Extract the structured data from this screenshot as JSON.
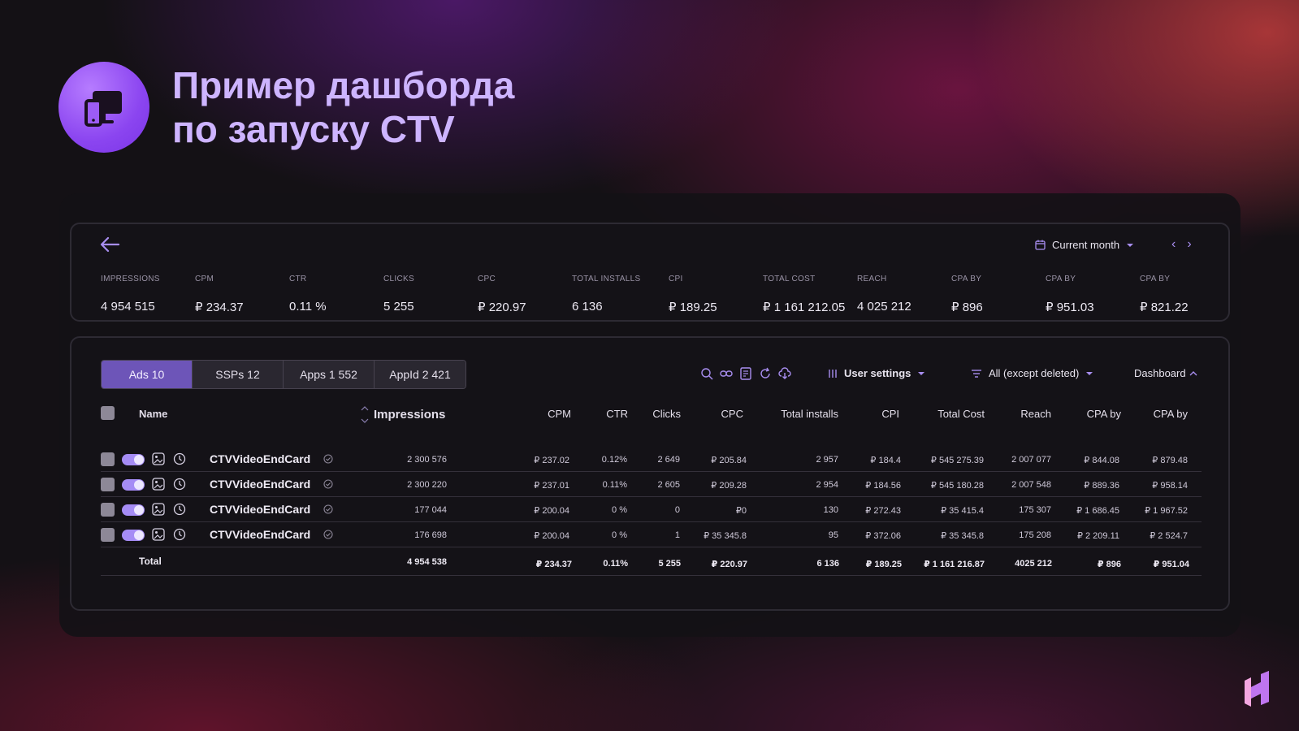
{
  "slide": {
    "title_line1": "Пример дашборда",
    "title_line2": "по запуску CTV"
  },
  "summary": {
    "period_label": "Current month",
    "metrics": [
      {
        "label": "IMPRESSIONS",
        "value": "4 954 515"
      },
      {
        "label": "CPM",
        "value": "₽ 234.37"
      },
      {
        "label": "CTR",
        "value": "0.11 %"
      },
      {
        "label": "CLICKS",
        "value": "5 255"
      },
      {
        "label": "CPC",
        "value": "₽ 220.97"
      },
      {
        "label": "TOTAL INSTALLS",
        "value": "6 136"
      },
      {
        "label": "CPI",
        "value": "₽ 189.25"
      },
      {
        "label": "TOTAL COST",
        "value": "₽ 1 161 212.05"
      },
      {
        "label": "REACH",
        "value": "4 025 212"
      },
      {
        "label": "CPA BY",
        "value": "₽ 896"
      },
      {
        "label": "CPA BY",
        "value": "₽ 951.03"
      },
      {
        "label": "CPA BY",
        "value": "₽ 821.22"
      }
    ]
  },
  "toolbar": {
    "tabs": [
      "Ads 10",
      "SSPs 12",
      "Apps 1 552",
      "AppId 2 421"
    ],
    "user_settings": "User settings",
    "filter": "All (except deleted)",
    "dashboard": "Dashboard"
  },
  "table": {
    "headers": [
      "Name",
      "Impressions",
      "CPM",
      "CTR",
      "Clicks",
      "CPC",
      "Total installs",
      "CPI",
      "Total Cost",
      "Reach",
      "CPA by",
      "CPA by"
    ],
    "rows": [
      {
        "name": "CTVVideoEndCard",
        "impressions": "2 300 576",
        "cpm": "₽ 237.02",
        "ctr": "0.12%",
        "clicks": "2 649",
        "cpc": "₽ 205.84",
        "installs": "2 957",
        "cpi": "₽ 184.4",
        "cost": "₽ 545 275.39",
        "reach": "2 007 077",
        "cpa1": "₽ 844.08",
        "cpa2": "₽ 879.48"
      },
      {
        "name": "CTVVideoEndCard",
        "impressions": "2 300 220",
        "cpm": "₽ 237.01",
        "ctr": "0.11%",
        "clicks": "2 605",
        "cpc": "₽ 209.28",
        "installs": "2 954",
        "cpi": "₽ 184.56",
        "cost": "₽ 545 180.28",
        "reach": "2 007 548",
        "cpa1": "₽ 889.36",
        "cpa2": "₽ 958.14"
      },
      {
        "name": "CTVVideoEndCard",
        "impressions": "177 044",
        "cpm": "₽ 200.04",
        "ctr": "0 %",
        "clicks": "0",
        "cpc": "₽0",
        "installs": "130",
        "cpi": "₽ 272.43",
        "cost": "₽ 35 415.4",
        "reach": "175 307",
        "cpa1": "₽ 1 686.45",
        "cpa2": "₽ 1 967.52"
      },
      {
        "name": "CTVVideoEndCard",
        "impressions": "176 698",
        "cpm": "₽ 200.04",
        "ctr": "0 %",
        "clicks": "1",
        "cpc": "₽ 35 345.8",
        "installs": "95",
        "cpi": "₽ 372.06",
        "cost": "₽ 35 345.8",
        "reach": "175 208",
        "cpa1": "₽ 2 209.11",
        "cpa2": "₽ 2 524.7"
      }
    ],
    "total": {
      "label": "Total",
      "impressions": "4 954 538",
      "cpm": "₽ 234.37",
      "ctr": "0.11%",
      "clicks": "5 255",
      "cpc": "₽ 220.97",
      "installs": "6 136",
      "cpi": "₽ 189.25",
      "cost": "₽ 1 161 216.87",
      "reach": "4025 212",
      "cpa1": "₽ 896",
      "cpa2": "₽ 951.04"
    }
  }
}
